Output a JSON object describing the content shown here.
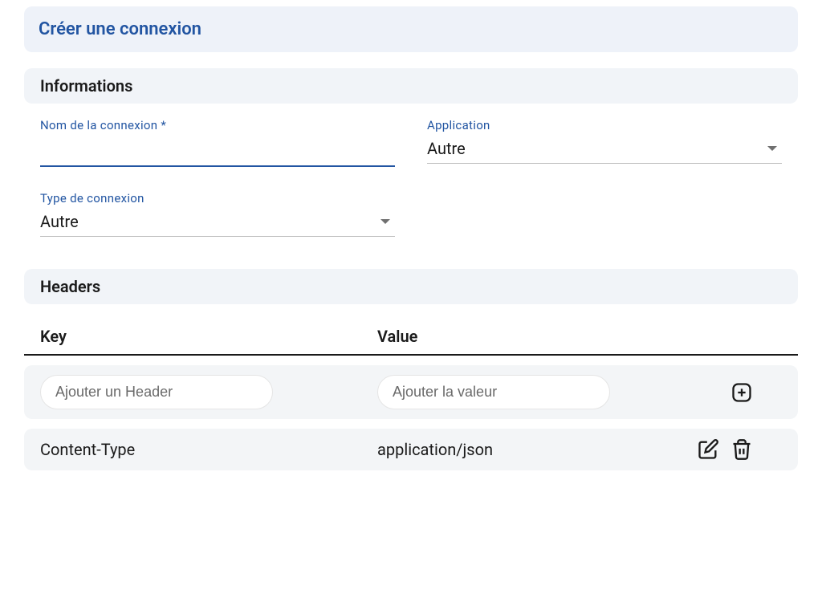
{
  "page": {
    "title": "Créer une connexion"
  },
  "sections": {
    "informations": {
      "title": "Informations",
      "fields": {
        "connection_name": {
          "label": "Nom de la connexion *",
          "value": ""
        },
        "application": {
          "label": "Application",
          "value": "Autre"
        },
        "connection_type": {
          "label": "Type de connexion",
          "value": "Autre"
        }
      }
    },
    "headers": {
      "title": "Headers",
      "columns": {
        "key": "Key",
        "value": "Value"
      },
      "add_row": {
        "key_placeholder": "Ajouter un Header",
        "value_placeholder": "Ajouter la valeur"
      },
      "rows": [
        {
          "key": "Content-Type",
          "value": "application/json"
        }
      ]
    }
  }
}
